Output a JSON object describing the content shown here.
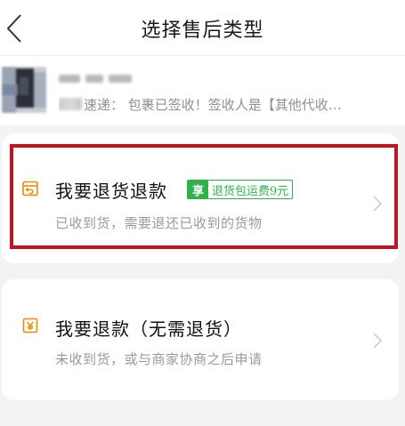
{
  "header": {
    "title": "选择售后类型"
  },
  "order": {
    "status_text": "： 包裹已签收！签收人是【其他代收…",
    "carrier_suffix": "速递"
  },
  "options": [
    {
      "title": "我要退货退款",
      "description": "已收到货，需要退还已收到的货物",
      "badge_tag": "享",
      "badge_text": "退货包运费9元",
      "highlighted": true
    },
    {
      "title": "我要退款（无需退货）",
      "description": "未收到货，或与商家协商之后申请",
      "highlighted": false
    }
  ],
  "colors": {
    "accent": "#f08a00",
    "highlight_border": "#c1141f",
    "badge_green": "#2fb24a",
    "muted_text": "#9a9a9a"
  },
  "icons": {
    "back": "chevron-left-icon",
    "return_refund": "return-box-icon",
    "refund_only": "yen-tag-icon",
    "row_arrow": "chevron-right-icon"
  }
}
